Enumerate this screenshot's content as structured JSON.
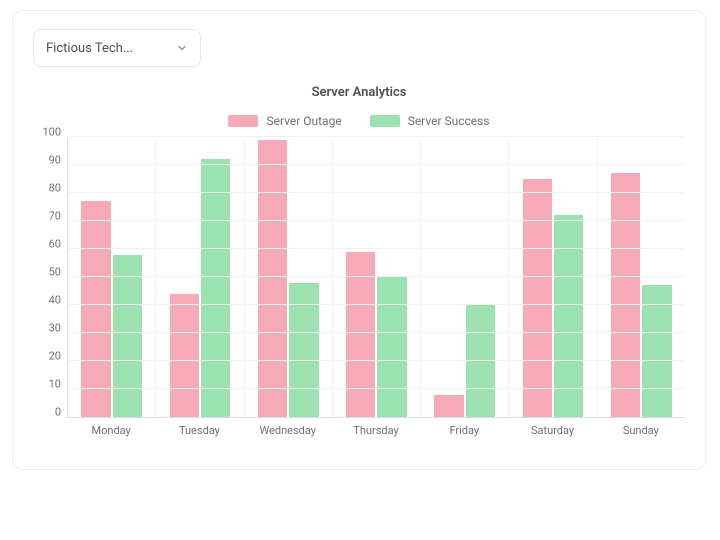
{
  "selector": {
    "label": "Fictious Tech..."
  },
  "chart_data": {
    "type": "bar",
    "title": "Server Analytics",
    "xlabel": "",
    "ylabel": "",
    "ylim": [
      0,
      100
    ],
    "yticks": [
      100,
      90,
      80,
      70,
      60,
      50,
      40,
      30,
      20,
      10,
      0
    ],
    "categories": [
      "Monday",
      "Tuesday",
      "Wednesday",
      "Thursday",
      "Friday",
      "Saturday",
      "Sunday"
    ],
    "series": [
      {
        "name": "Server Outage",
        "color": "#f6a9b6",
        "values": [
          77,
          44,
          99,
          59,
          8,
          85,
          87
        ]
      },
      {
        "name": "Server Success",
        "color": "#9be2b0",
        "values": [
          58,
          92,
          48,
          50,
          40,
          72,
          47
        ]
      }
    ]
  }
}
